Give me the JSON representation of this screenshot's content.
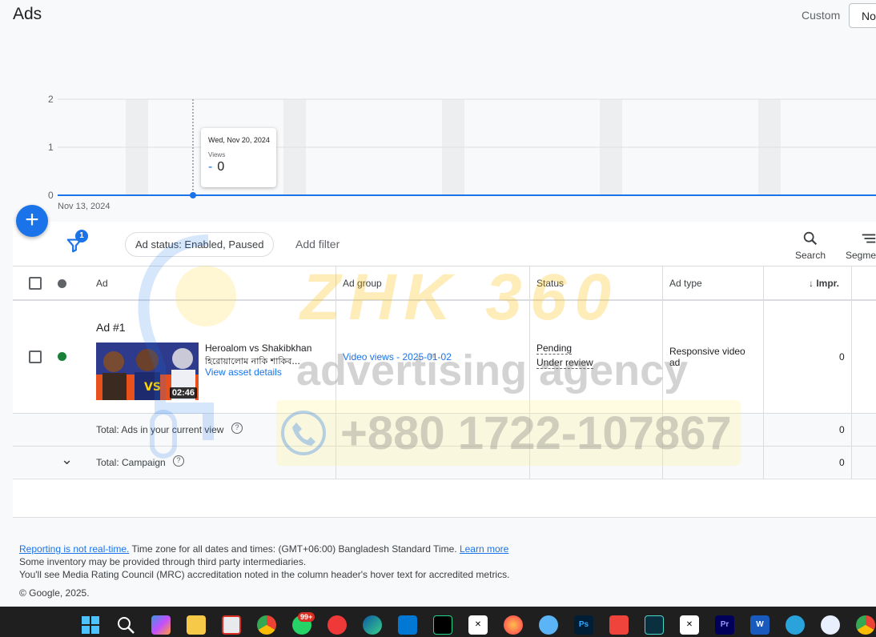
{
  "header": {
    "title": "Ads",
    "date_range_label": "Custom",
    "date_range_button": "No"
  },
  "chart_data": {
    "type": "line",
    "x": [
      "Nov 13, 2024",
      "Nov 20, 2024"
    ],
    "series": [
      {
        "name": "Views",
        "values": [
          0,
          0
        ]
      }
    ],
    "yticks": [
      0,
      1,
      2
    ],
    "ylim": [
      0,
      2
    ],
    "first_x_label": "Nov 13, 2024",
    "tooltip": {
      "date": "Wed, Nov 20, 2024",
      "metric": "Views",
      "value": "0",
      "dash": "-"
    },
    "colors": {
      "line": "#1a73e8",
      "weekend_band": "#e8eaed",
      "grid": "#e0e0e0"
    }
  },
  "toolbar": {
    "filter_count": "1",
    "status_filter": "Ad status: Enabled, Paused",
    "add_filter": "Add filter",
    "search_label": "Search",
    "segment_label": "Segme"
  },
  "table": {
    "headers": {
      "ad": "Ad",
      "ad_group": "Ad group",
      "status": "Status",
      "ad_type": "Ad type",
      "impr": "Impr."
    },
    "row": {
      "ad_name": "Ad #1",
      "video_title": "Heroalom vs Shakibkhan",
      "video_title_bn": "হিরোয়ালোম নাকি শাকিব...",
      "view_asset": "View asset details",
      "duration": "02:46",
      "ad_group": "Video views - 2025-01-02",
      "status_1": "Pending",
      "status_2": "Under review",
      "ad_type": "Responsive video ad",
      "impr": "0",
      "status_color": "#188038"
    },
    "total_view_label": "Total: Ads in your current view",
    "total_view_impr": "0",
    "total_campaign_label": "Total: Campaign",
    "total_campaign_impr": "0"
  },
  "footer": {
    "link1": "Reporting is not real-time.",
    "line1": " Time zone for all dates and times: (GMT+06:00) Bangladesh Standard Time. ",
    "link2": "Learn more",
    "line2": "Some inventory may be provided through third party intermediaries.",
    "line3": "You'll see Media Rating Council (MRC) accreditation noted in the column header's hover text for accredited metrics.",
    "copyright": "© Google, 2025."
  },
  "watermark": {
    "title": "ZHK 360",
    "subtitle": "advertising agency",
    "phone": "+880 1722-107867"
  },
  "taskbar": {
    "badge": "99+",
    "icons": [
      "windows-start",
      "search",
      "copilot",
      "file-explorer",
      "snipping-tool",
      "chrome",
      "whatsapp",
      "vivaldi",
      "edge",
      "store",
      "pycharm",
      "capcut",
      "firefox",
      "sync",
      "photoshop",
      "anydesk",
      "filmora",
      "capcut-2",
      "premiere",
      "word",
      "telegram",
      "app",
      "chrome-2"
    ],
    "ps_label": "Ps",
    "pr_label": "Pr",
    "w_label": "W"
  }
}
